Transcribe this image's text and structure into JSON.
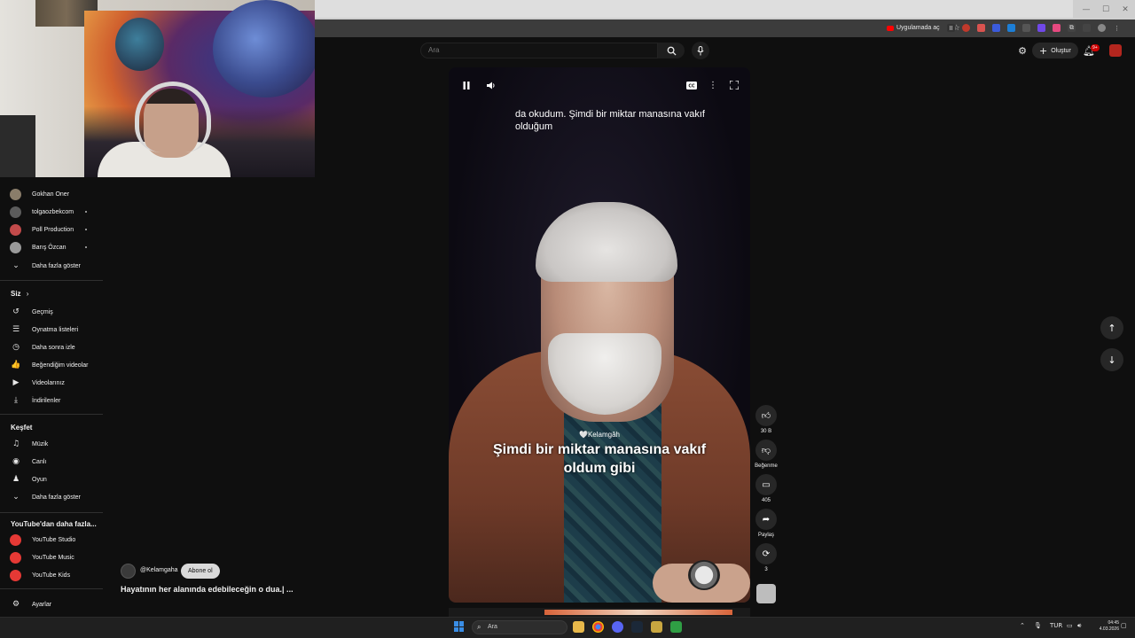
{
  "browser": {
    "open_in_app_label": "Uygulamada aç"
  },
  "header": {
    "search_placeholder": "Ara",
    "create_label": "Oluştur",
    "notifications_badge": "9+"
  },
  "sidebar": {
    "subscriptions": [
      {
        "label": "Gokhan Oner",
        "color": "#8a7d6a",
        "dot": false
      },
      {
        "label": "tolgaozbekcom",
        "color": "#5c5c5c",
        "dot": true
      },
      {
        "label": "Poll Production",
        "color": "#c24a4a",
        "dot": true
      },
      {
        "label": "Barış Özcan",
        "color": "#9a9a9a",
        "dot": true
      }
    ],
    "show_more_subs": "Daha fazla göster",
    "you_section": "Siz",
    "you_items": [
      {
        "label": "Geçmiş",
        "icon": "history-icon",
        "glyph": "↺"
      },
      {
        "label": "Oynatma listeleri",
        "icon": "playlist-icon",
        "glyph": "☰"
      },
      {
        "label": "Daha sonra izle",
        "icon": "clock-icon",
        "glyph": "◷"
      },
      {
        "label": "Beğendiğim videolar",
        "icon": "thumbs-up-icon",
        "glyph": "👍"
      },
      {
        "label": "Videolarınız",
        "icon": "video-icon",
        "glyph": "▶"
      },
      {
        "label": "İndirilenler",
        "icon": "download-icon",
        "glyph": "⤓"
      }
    ],
    "explore_section": "Keşfet",
    "explore_items": [
      {
        "label": "Müzik",
        "icon": "music-icon",
        "glyph": "♫"
      },
      {
        "label": "Canlı",
        "icon": "live-icon",
        "glyph": "◉"
      },
      {
        "label": "Oyun",
        "icon": "gaming-icon",
        "glyph": "♟"
      }
    ],
    "show_more_explore": "Daha fazla göster",
    "more_section": "YouTube'dan daha fazla...",
    "more_items": [
      {
        "label": "YouTube Studio",
        "color": "#e53935"
      },
      {
        "label": "YouTube Music",
        "color": "#e53935"
      },
      {
        "label": "YouTube Kids",
        "color": "#e53935"
      }
    ],
    "settings_label": "Ayarlar"
  },
  "player": {
    "top_caption": "da okudum. Şimdi bir miktar manasına vakıf olduğum",
    "brand": "🤍Kelamgâh",
    "caption": "Şimdi bir miktar manasına vakıf oldum gibi"
  },
  "actions": {
    "like_count": "30 B",
    "dislike_label": "Beğenme",
    "comments_count": "405",
    "share_label": "Paylaş",
    "remix_count": "3"
  },
  "channel": {
    "handle": "@Kelamgaha",
    "subscribe_label": "Abone ol",
    "video_title": "Hayatının her alanında edebileceğin o dua.| ..."
  },
  "taskbar": {
    "search_placeholder": "Ara",
    "language": "TUR",
    "time": "04:45",
    "date": "4.03.2026"
  },
  "colors": {
    "background": "#0f0f0f",
    "accent": "#ff0000",
    "button_bg": "#272727"
  }
}
